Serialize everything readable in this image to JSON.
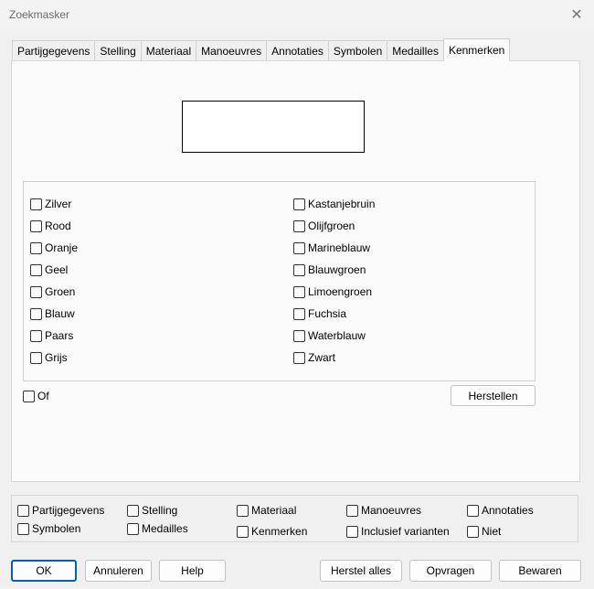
{
  "window": {
    "title": "Zoekmasker"
  },
  "tabs": [
    {
      "label": "Partijgegevens"
    },
    {
      "label": "Stelling"
    },
    {
      "label": "Materiaal"
    },
    {
      "label": "Manoeuvres"
    },
    {
      "label": "Annotaties"
    },
    {
      "label": "Symbolen"
    },
    {
      "label": "Medailles"
    },
    {
      "label": "Kenmerken",
      "active": true
    }
  ],
  "colors_left": [
    {
      "label": "Zilver",
      "checked": false
    },
    {
      "label": "Rood",
      "checked": false
    },
    {
      "label": "Oranje",
      "checked": false
    },
    {
      "label": "Geel",
      "checked": false
    },
    {
      "label": "Groen",
      "checked": false
    },
    {
      "label": "Blauw",
      "checked": false
    },
    {
      "label": "Paars",
      "checked": false
    },
    {
      "label": "Grijs",
      "checked": false
    }
  ],
  "colors_right": [
    {
      "label": "Kastanjebruin",
      "checked": false
    },
    {
      "label": "Olijfgroen",
      "checked": false
    },
    {
      "label": "Marineblauw",
      "checked": false
    },
    {
      "label": "Blauwgroen",
      "checked": false
    },
    {
      "label": "Limoengroen",
      "checked": false
    },
    {
      "label": "Fuchsia",
      "checked": false
    },
    {
      "label": "Waterblauw",
      "checked": false
    },
    {
      "label": "Zwart",
      "checked": false
    }
  ],
  "or_option": {
    "label": "Of",
    "checked": false
  },
  "reset_button": "Herstellen",
  "filters": {
    "partijgegevens": "Partijgegevens",
    "symbolen": "Symbolen",
    "stelling": "Stelling",
    "medailles": "Medailles",
    "materiaal": "Materiaal",
    "kenmerken": "Kenmerken",
    "manoeuvres": "Manoeuvres",
    "inclusief_varianten": "Inclusief varianten",
    "annotaties": "Annotaties",
    "niet": "Niet"
  },
  "buttons": {
    "ok": "OK",
    "cancel": "Annuleren",
    "help": "Help",
    "reset_all": "Herstel alles",
    "query": "Opvragen",
    "save": "Bewaren"
  }
}
